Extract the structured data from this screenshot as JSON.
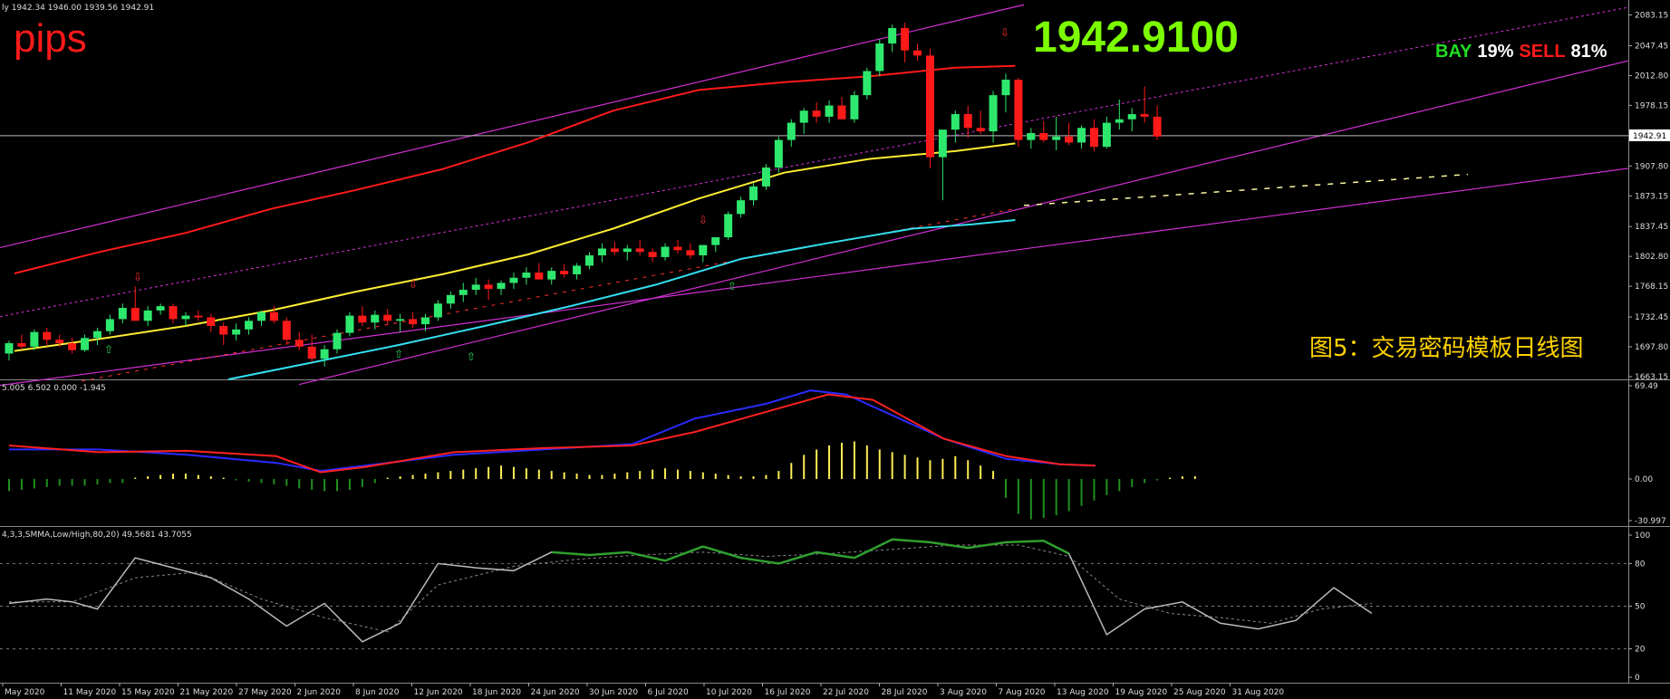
{
  "header": {
    "ohlc_text": "ly  1942.34 1946.00 1939.56 1942.91"
  },
  "overlay": {
    "pips": "pips",
    "big_price": "1942.9100",
    "buy_label": "BAY",
    "buy_pct": "19%",
    "sell_label": "SELL",
    "sell_pct": "81%",
    "caption": "图5：交易密码模板日线图"
  },
  "colors": {
    "bull": "#2ee86e",
    "bear": "#ff1a1a",
    "channel": "#d22fd6",
    "ema_red": "#ff1a1a",
    "ema_yellow": "#ffee33",
    "ema_cyan": "#33e0f0",
    "macd_main": "#ff2020",
    "macd_signal": "#2a2aff",
    "hist_pos": "#ffee55",
    "hist_neg": "#1f8f1f",
    "stoch_main": "#b8b8c0",
    "stoch_signal": "#888888",
    "stoch_high": "#2f9f2f",
    "stoch_low": "#ff1a1a"
  },
  "chart_data": [
    {
      "type": "candlestick",
      "title": "",
      "current_price": "1942.91",
      "price_axis_ticks": [
        "2083.15",
        "2047.45",
        "2012.80",
        "1978.15",
        "1942.91",
        "1907.80",
        "1873.15",
        "1837.45",
        "1802.80",
        "1768.15",
        "1732.45",
        "1697.80",
        "1663.15"
      ],
      "x_tick_labels": [
        "May 2020",
        "11 May 2020",
        "15 May 2020",
        "21 May 2020",
        "27 May 2020",
        "2 Jun 2020",
        "8 Jun 2020",
        "12 Jun 2020",
        "18 Jun 2020",
        "24 Jun 2020",
        "30 Jun 2020",
        "6 Jul 2020",
        "10 Jul 2020",
        "16 Jul 2020",
        "22 Jul 2020",
        "28 Jul 2020",
        "3 Aug 2020",
        "7 Aug 2020",
        "13 Aug 2020",
        "19 Aug 2020",
        "25 Aug 2020",
        "31 Aug 2020"
      ],
      "ylim": [
        1663.15,
        2090
      ],
      "candles": [
        [
          1690,
          1705,
          1682,
          1702
        ],
        [
          1702,
          1712,
          1695,
          1698
        ],
        [
          1698,
          1718,
          1694,
          1715
        ],
        [
          1715,
          1720,
          1700,
          1706
        ],
        [
          1706,
          1712,
          1698,
          1702
        ],
        [
          1702,
          1708,
          1690,
          1694
        ],
        [
          1694,
          1712,
          1692,
          1708
        ],
        [
          1708,
          1720,
          1700,
          1716
        ],
        [
          1716,
          1735,
          1712,
          1730
        ],
        [
          1730,
          1748,
          1725,
          1743
        ],
        [
          1743,
          1768,
          1738,
          1728
        ],
        [
          1728,
          1745,
          1722,
          1740
        ],
        [
          1740,
          1748,
          1735,
          1745
        ],
        [
          1745,
          1748,
          1725,
          1730
        ],
        [
          1730,
          1738,
          1722,
          1734
        ],
        [
          1734,
          1740,
          1728,
          1732
        ],
        [
          1732,
          1736,
          1715,
          1722
        ],
        [
          1722,
          1726,
          1700,
          1712
        ],
        [
          1712,
          1725,
          1705,
          1718
        ],
        [
          1718,
          1732,
          1712,
          1728
        ],
        [
          1728,
          1740,
          1722,
          1738
        ],
        [
          1738,
          1745,
          1725,
          1728
        ],
        [
          1728,
          1732,
          1700,
          1706
        ],
        [
          1706,
          1715,
          1694,
          1698
        ],
        [
          1698,
          1712,
          1680,
          1684
        ],
        [
          1684,
          1700,
          1675,
          1695
        ],
        [
          1695,
          1718,
          1690,
          1714
        ],
        [
          1714,
          1738,
          1710,
          1734
        ],
        [
          1734,
          1745,
          1722,
          1726
        ],
        [
          1726,
          1740,
          1718,
          1735
        ],
        [
          1735,
          1742,
          1724,
          1728
        ],
        [
          1728,
          1736,
          1715,
          1730
        ],
        [
          1730,
          1738,
          1720,
          1724
        ],
        [
          1724,
          1736,
          1716,
          1732
        ],
        [
          1732,
          1752,
          1728,
          1748
        ],
        [
          1748,
          1762,
          1742,
          1758
        ],
        [
          1758,
          1772,
          1750,
          1764
        ],
        [
          1764,
          1778,
          1758,
          1770
        ],
        [
          1770,
          1776,
          1752,
          1765
        ],
        [
          1765,
          1775,
          1758,
          1772
        ],
        [
          1772,
          1784,
          1765,
          1778
        ],
        [
          1778,
          1790,
          1770,
          1784
        ],
        [
          1784,
          1795,
          1778,
          1776
        ],
        [
          1776,
          1790,
          1770,
          1786
        ],
        [
          1786,
          1794,
          1778,
          1782
        ],
        [
          1782,
          1795,
          1776,
          1792
        ],
        [
          1792,
          1808,
          1788,
          1804
        ],
        [
          1804,
          1818,
          1796,
          1812
        ],
        [
          1812,
          1820,
          1804,
          1808
        ],
        [
          1808,
          1816,
          1798,
          1812
        ],
        [
          1812,
          1822,
          1804,
          1808
        ],
        [
          1808,
          1812,
          1796,
          1802
        ],
        [
          1802,
          1818,
          1798,
          1814
        ],
        [
          1814,
          1822,
          1806,
          1810
        ],
        [
          1810,
          1818,
          1800,
          1804
        ],
        [
          1804,
          1812,
          1796,
          1816
        ],
        [
          1816,
          1822,
          1808,
          1825
        ],
        [
          1825,
          1855,
          1822,
          1852
        ],
        [
          1852,
          1872,
          1848,
          1868
        ],
        [
          1868,
          1888,
          1862,
          1884
        ],
        [
          1884,
          1910,
          1880,
          1906
        ],
        [
          1906,
          1942,
          1900,
          1938
        ],
        [
          1938,
          1962,
          1930,
          1958
        ],
        [
          1958,
          1975,
          1945,
          1972
        ],
        [
          1972,
          1982,
          1958,
          1965
        ],
        [
          1965,
          1984,
          1958,
          1978
        ],
        [
          1978,
          1988,
          1962,
          1962
        ],
        [
          1962,
          1995,
          1958,
          1990
        ],
        [
          1990,
          2022,
          1985,
          2018
        ],
        [
          2018,
          2055,
          2012,
          2050
        ],
        [
          2050,
          2072,
          2040,
          2068
        ],
        [
          2068,
          2074,
          2028,
          2042
        ],
        [
          2042,
          2050,
          2030,
          2036
        ],
        [
          2036,
          2044,
          1905,
          1918
        ],
        [
          1918,
          1930,
          1868,
          1950
        ],
        [
          1950,
          1972,
          1935,
          1968
        ],
        [
          1968,
          1978,
          1940,
          1952
        ],
        [
          1952,
          1972,
          1945,
          1948
        ],
        [
          1948,
          1995,
          1935,
          1990
        ],
        [
          1990,
          2015,
          1970,
          2008
        ],
        [
          2008,
          2010,
          1930,
          1938
        ],
        [
          1938,
          1952,
          1928,
          1946
        ],
        [
          1946,
          1960,
          1935,
          1938
        ],
        [
          1938,
          1965,
          1926,
          1942
        ],
        [
          1942,
          1958,
          1932,
          1935
        ],
        [
          1935,
          1955,
          1928,
          1952
        ],
        [
          1952,
          1962,
          1925,
          1930
        ],
        [
          1930,
          1965,
          1928,
          1958
        ],
        [
          1958,
          1985,
          1950,
          1962
        ],
        [
          1962,
          1975,
          1948,
          1968
        ],
        [
          1968,
          2000,
          1958,
          1965
        ],
        [
          1965,
          1978,
          1938,
          1942
        ]
      ],
      "ema_red": [
        [
          0,
          1783
        ],
        [
          10,
          1808
        ],
        [
          20,
          1830
        ],
        [
          30,
          1858
        ],
        [
          40,
          1880
        ],
        [
          50,
          1904
        ],
        [
          60,
          1935
        ],
        [
          70,
          1972
        ],
        [
          80,
          1996
        ],
        [
          90,
          2005
        ],
        [
          100,
          2012
        ],
        [
          110,
          2022
        ],
        [
          117,
          2024
        ]
      ],
      "ema_yellow": [
        [
          0,
          1693
        ],
        [
          10,
          1707
        ],
        [
          20,
          1722
        ],
        [
          30,
          1740
        ],
        [
          40,
          1762
        ],
        [
          50,
          1782
        ],
        [
          60,
          1805
        ],
        [
          70,
          1835
        ],
        [
          80,
          1870
        ],
        [
          90,
          1900
        ],
        [
          100,
          1916
        ],
        [
          110,
          1925
        ],
        [
          117,
          1934
        ]
      ],
      "ema_cyan": [
        [
          25,
          1660
        ],
        [
          35,
          1680
        ],
        [
          45,
          1700
        ],
        [
          55,
          1722
        ],
        [
          65,
          1745
        ],
        [
          75,
          1770
        ],
        [
          85,
          1800
        ],
        [
          95,
          1818
        ],
        [
          105,
          1835
        ],
        [
          112,
          1840
        ],
        [
          117,
          1845
        ]
      ]
    },
    {
      "type": "macd",
      "header": "5.005 6.502 0.000 -1.945",
      "ylim": [
        -30.997,
        69.49
      ],
      "y_tick_labels": [
        "69.49",
        "0.00",
        "-30.997"
      ],
      "histogram": [
        -9,
        -8,
        -7,
        -6,
        -5,
        -5,
        -5,
        -4,
        -3,
        -3,
        1,
        2,
        3,
        4,
        4,
        3,
        2,
        1,
        -1,
        -2,
        -3,
        -4,
        -5,
        -7,
        -8,
        -9,
        -9,
        -8,
        -6,
        -3,
        1,
        2,
        3,
        4,
        5,
        6,
        7,
        8,
        9,
        10,
        9,
        8,
        7,
        6,
        5,
        4,
        3,
        3,
        4,
        5,
        6,
        7,
        8,
        7,
        6,
        5,
        4,
        3,
        2,
        2,
        3,
        6,
        12,
        18,
        22,
        25,
        27,
        28,
        25,
        22,
        20,
        18,
        16,
        14,
        15,
        17,
        14,
        10,
        6,
        -14,
        -26,
        -30,
        -29,
        -27,
        -24,
        -20,
        -16,
        -12,
        -9,
        -6,
        -3,
        -1,
        1,
        2,
        2
      ],
      "main": [
        [
          0,
          25
        ],
        [
          10,
          20
        ],
        [
          20,
          21
        ],
        [
          30,
          17
        ],
        [
          35,
          5
        ],
        [
          40,
          9
        ],
        [
          50,
          20
        ],
        [
          60,
          23
        ],
        [
          70,
          25
        ],
        [
          77,
          35
        ],
        [
          85,
          50
        ],
        [
          92,
          63
        ],
        [
          97,
          59
        ],
        [
          105,
          30
        ],
        [
          112,
          17
        ],
        [
          118,
          11
        ],
        [
          122,
          10
        ]
      ],
      "signal": [
        [
          0,
          22
        ],
        [
          10,
          22
        ],
        [
          20,
          18
        ],
        [
          30,
          12
        ],
        [
          35,
          6
        ],
        [
          40,
          10
        ],
        [
          50,
          18
        ],
        [
          60,
          22
        ],
        [
          70,
          26
        ],
        [
          77,
          45
        ],
        [
          85,
          56
        ],
        [
          90,
          66
        ],
        [
          94,
          63
        ],
        [
          100,
          45
        ],
        [
          105,
          30
        ],
        [
          112,
          15
        ],
        [
          118,
          11
        ],
        [
          122,
          10
        ]
      ]
    },
    {
      "type": "stochastic",
      "header": "4,3,3,SMMA,Low/High,80,20) 49.5681 43.7055",
      "ylim": [
        0,
        100
      ],
      "y_tick_labels": [
        "100",
        "80",
        "50",
        "20",
        "0"
      ],
      "main": [
        [
          0,
          52
        ],
        [
          3,
          55
        ],
        [
          5,
          53
        ],
        [
          7,
          48
        ],
        [
          10,
          84
        ],
        [
          13,
          77
        ],
        [
          16,
          70
        ],
        [
          19,
          55
        ],
        [
          22,
          36
        ],
        [
          25,
          52
        ],
        [
          28,
          25
        ],
        [
          31,
          38
        ],
        [
          34,
          80
        ],
        [
          37,
          77
        ],
        [
          40,
          75
        ],
        [
          43,
          88
        ],
        [
          46,
          86
        ],
        [
          49,
          88
        ],
        [
          52,
          82
        ],
        [
          55,
          92
        ],
        [
          58,
          84
        ],
        [
          61,
          80
        ],
        [
          64,
          88
        ],
        [
          67,
          84
        ],
        [
          70,
          97
        ],
        [
          73,
          95
        ],
        [
          76,
          91
        ],
        [
          79,
          95
        ],
        [
          82,
          96
        ],
        [
          84,
          87
        ],
        [
          87,
          30
        ],
        [
          90,
          48
        ],
        [
          93,
          53
        ],
        [
          96,
          38
        ],
        [
          99,
          34
        ],
        [
          102,
          40
        ],
        [
          105,
          63
        ],
        [
          108,
          45
        ]
      ],
      "signal": [
        [
          0,
          53
        ],
        [
          5,
          53
        ],
        [
          10,
          70
        ],
        [
          15,
          74
        ],
        [
          20,
          55
        ],
        [
          25,
          42
        ],
        [
          30,
          32
        ],
        [
          34,
          65
        ],
        [
          40,
          78
        ],
        [
          45,
          83
        ],
        [
          50,
          86
        ],
        [
          55,
          88
        ],
        [
          60,
          85
        ],
        [
          65,
          87
        ],
        [
          70,
          90
        ],
        [
          75,
          93
        ],
        [
          80,
          93
        ],
        [
          84,
          85
        ],
        [
          88,
          55
        ],
        [
          92,
          45
        ],
        [
          96,
          42
        ],
        [
          100,
          38
        ],
        [
          104,
          48
        ],
        [
          108,
          52
        ]
      ],
      "levels": [
        80,
        50,
        20
      ]
    }
  ]
}
